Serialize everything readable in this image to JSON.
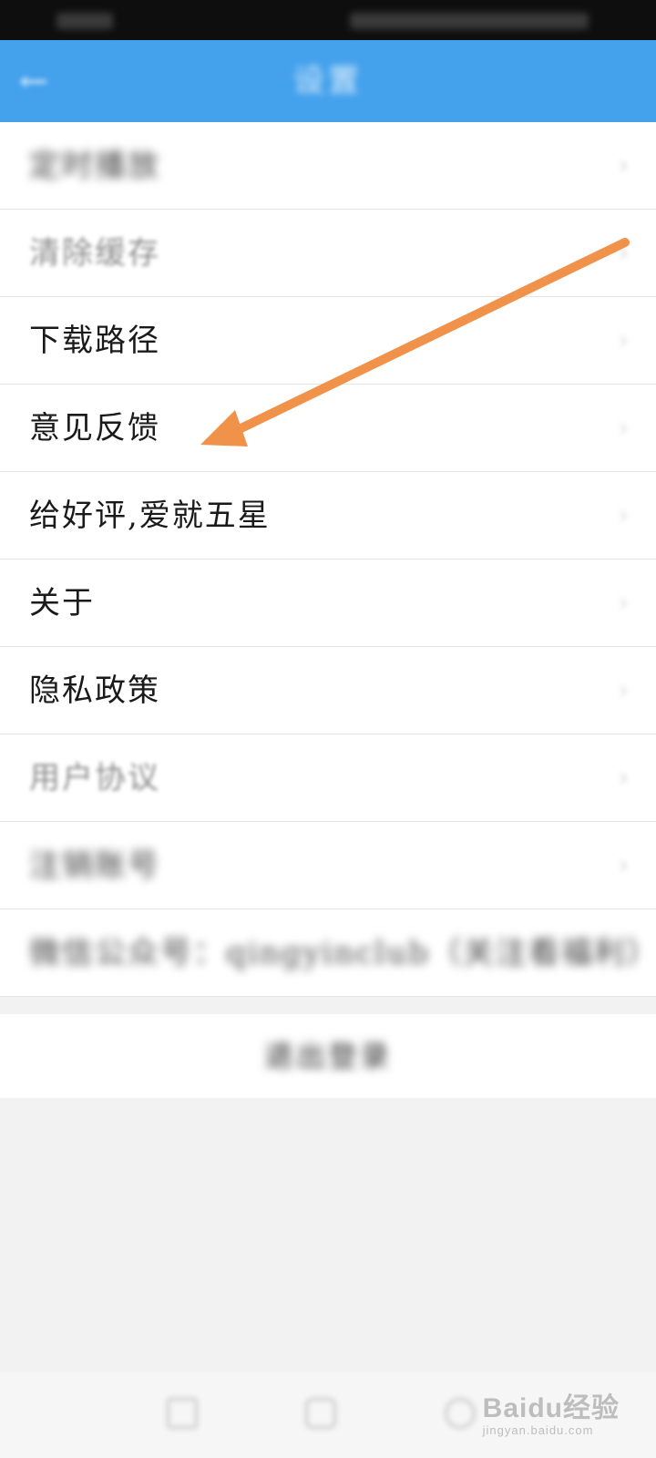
{
  "status_bar": {},
  "app_bar": {
    "back_icon": "back-arrow-icon",
    "title": "设置"
  },
  "settings": {
    "items": [
      {
        "label": "定时播放",
        "state": "blurred"
      },
      {
        "label": "清除缓存",
        "state": "faded"
      },
      {
        "label": "下载路径",
        "state": "clear"
      },
      {
        "label": "意见反馈",
        "state": "clear"
      },
      {
        "label": "给好评,爱就五星",
        "state": "clear"
      },
      {
        "label": "关于",
        "state": "clear"
      },
      {
        "label": "隐私政策",
        "state": "clear"
      },
      {
        "label": "用户协议",
        "state": "faded"
      },
      {
        "label": "注销账号",
        "state": "blurred"
      },
      {
        "label": "微信公众号：qingyinclub（关注看福利）",
        "state": "blurred"
      }
    ],
    "chevron_icon": "chevron-right-icon",
    "chevron_glyph": "›"
  },
  "logout": {
    "label": "退出登录"
  },
  "annotation": {
    "icon": "orange-arrow-annotation",
    "color": "#f0924a",
    "points_to": "意见反馈"
  },
  "nav_bar": {
    "buttons": [
      "recent-apps-icon",
      "home-icon",
      "back-icon"
    ]
  },
  "watermark": {
    "brand": "Baidu经验",
    "sub": "jingyan.baidu.com"
  },
  "colors": {
    "app_bar": "#44a1ec",
    "status_bar": "#0e0e0e",
    "background": "#f2f2f2"
  }
}
